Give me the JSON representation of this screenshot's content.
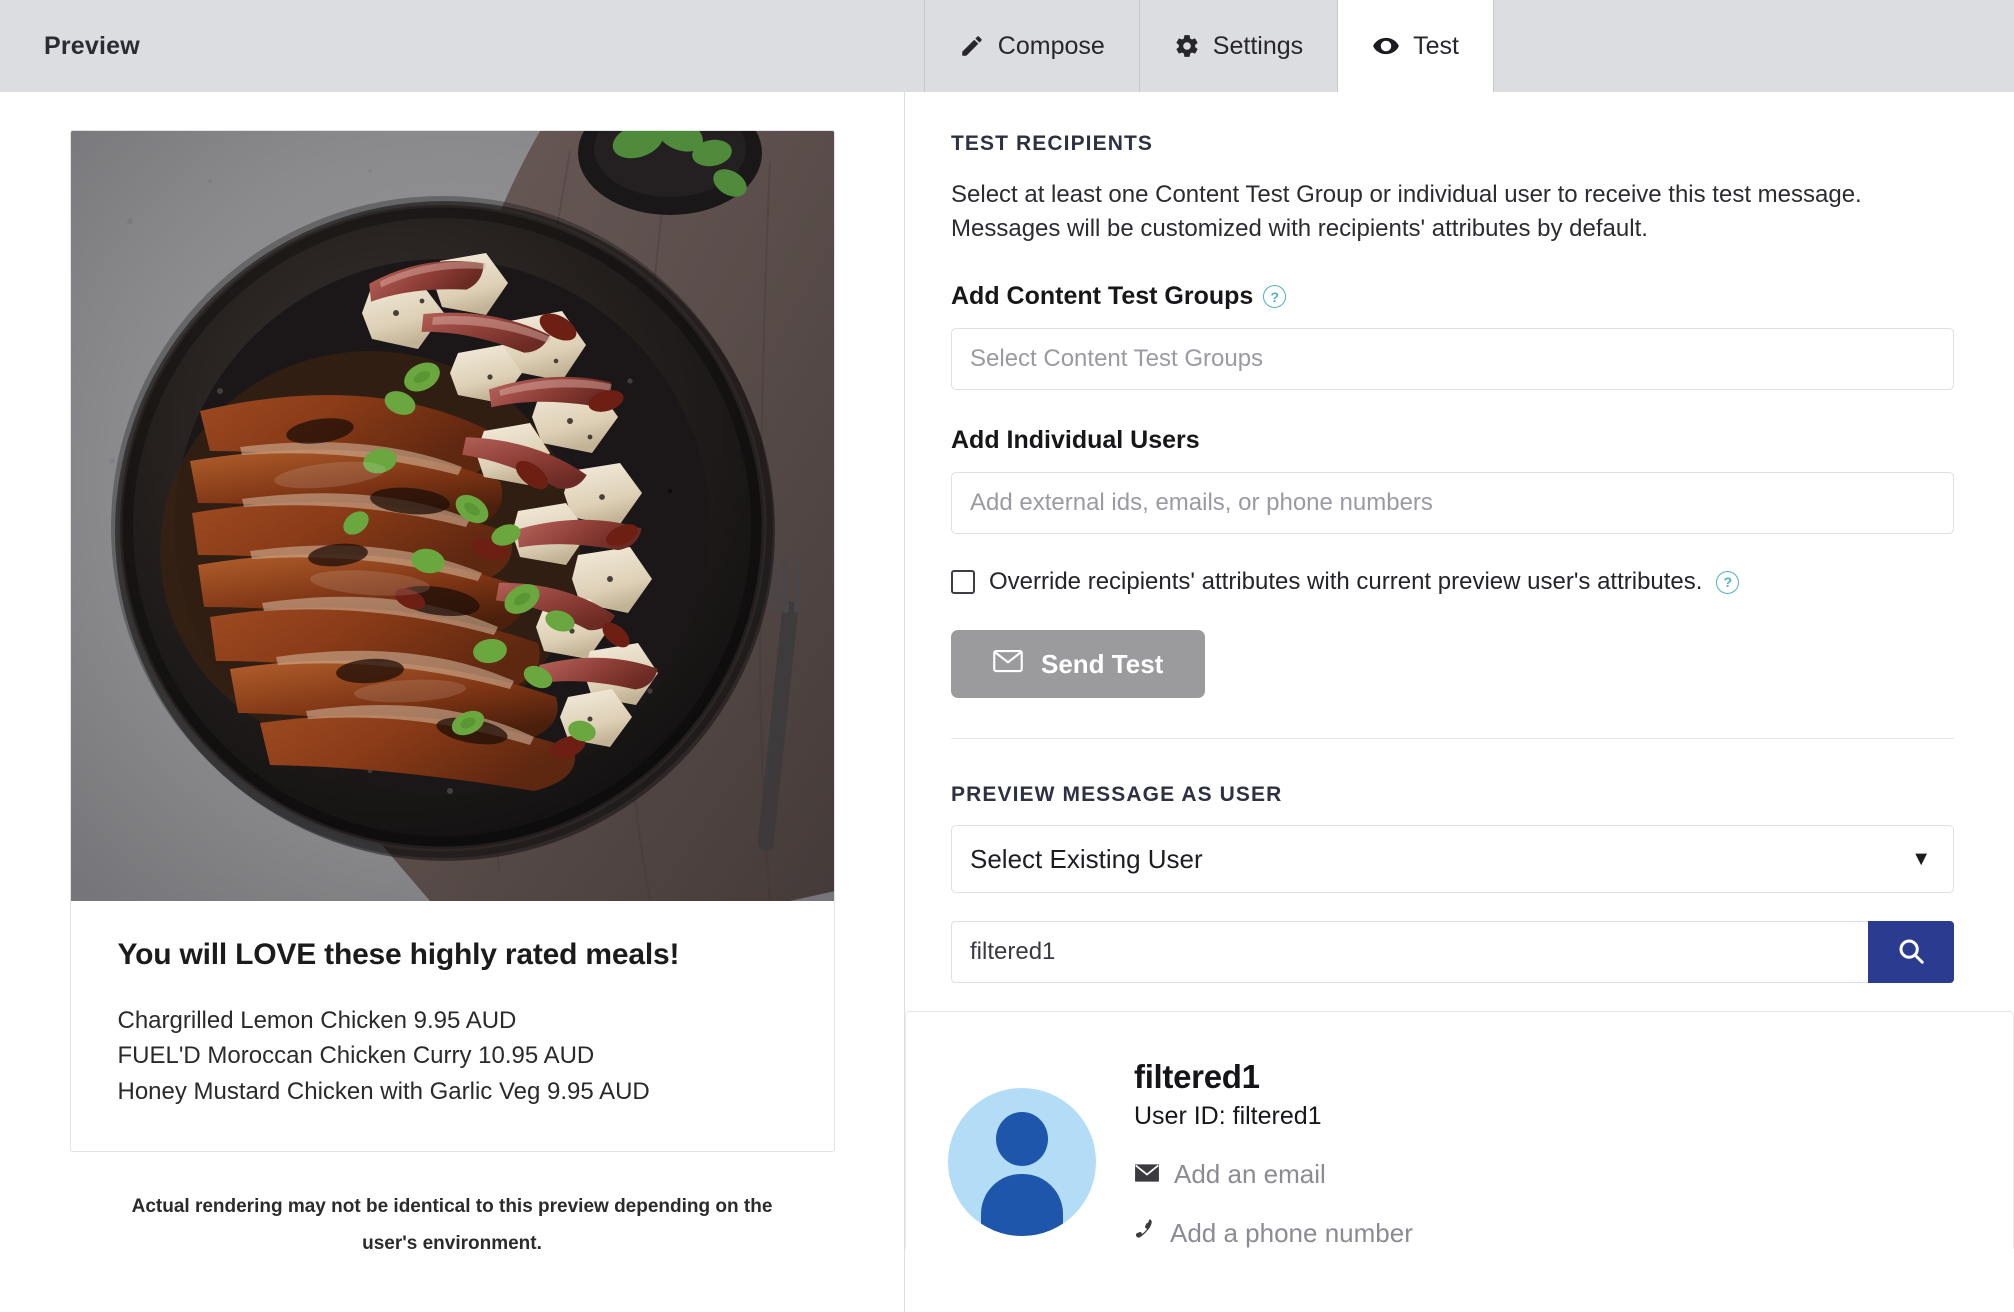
{
  "header": {
    "title": "Preview",
    "tabs": [
      {
        "label": "Compose",
        "icon": "pencil-icon",
        "active": false
      },
      {
        "label": "Settings",
        "icon": "gear-icon",
        "active": false
      },
      {
        "label": "Test",
        "icon": "eye-icon",
        "active": true
      }
    ]
  },
  "preview": {
    "headline": "You will LOVE these highly rated meals!",
    "items": [
      "Chargrilled Lemon Chicken  9.95 AUD",
      "FUEL'D Moroccan Chicken Curry  10.95 AUD",
      "Honey Mustard Chicken with Garlic Veg  9.95 AUD"
    ],
    "image_alt": "chargrilled-chicken-skillet-photo",
    "disclaimer": "Actual rendering may not be identical to this preview depending on the user's environment."
  },
  "test_recipients": {
    "section_title": "TEST RECIPIENTS",
    "description": "Select at least one Content Test Group or individual user to receive this test message. Messages will be customized with recipients' attributes by default.",
    "content_groups_label": "Add Content Test Groups",
    "content_groups_help": "?",
    "content_groups_placeholder": "Select Content Test Groups",
    "content_groups_value": "",
    "individual_users_label": "Add Individual Users",
    "individual_users_placeholder": "Add external ids, emails, or phone numbers",
    "individual_users_value": "",
    "override_label": "Override recipients' attributes with current preview user's attributes.",
    "override_help": "?",
    "override_checked": false,
    "send_button_label": "Send Test",
    "send_button_icon": "envelope-icon"
  },
  "preview_as_user": {
    "section_title": "PREVIEW MESSAGE AS USER",
    "select_value": "Select Existing User",
    "select_caret": "▼",
    "search_value": "filtered1",
    "search_placeholder": "",
    "search_icon": "search-icon",
    "result": {
      "name": "filtered1",
      "user_id_label": "User ID: filtered1",
      "add_email_label": "Add an email",
      "add_email_icon": "envelope-icon",
      "add_phone_label": "Add a phone number",
      "add_phone_icon": "phone-icon",
      "avatar_icon": "user-avatar-icon"
    }
  },
  "colors": {
    "topbar_bg": "#dcdde1",
    "search_button": "#2b3b8f",
    "send_button": "#9b9b9e",
    "help_icon": "#4fb3bb",
    "avatar_bg": "#b3ddf7",
    "avatar_fg": "#1d56ab",
    "section_title": "#2d3142"
  }
}
